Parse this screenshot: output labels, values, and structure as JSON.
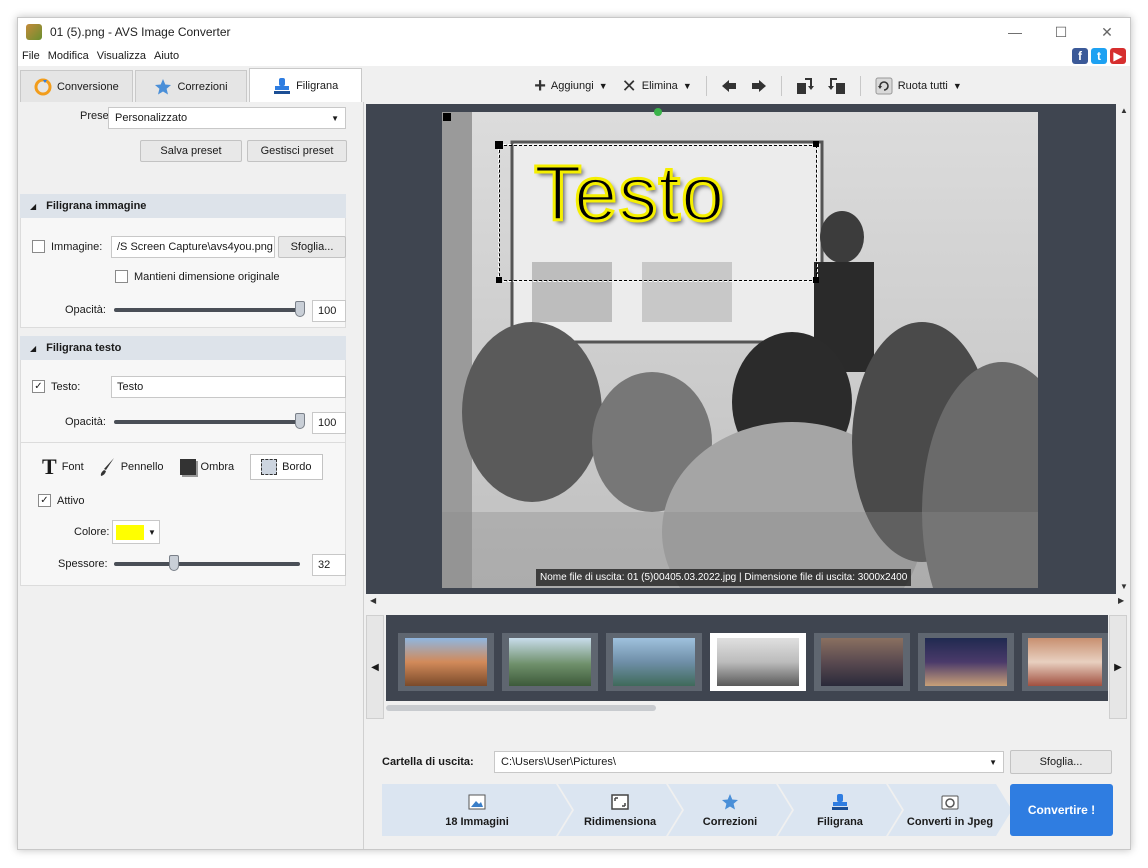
{
  "window": {
    "title": "01 (5).png - AVS Image Converter",
    "controls": {
      "minimize": "—",
      "maximize": "☐",
      "close": "✕"
    }
  },
  "menu": [
    "File",
    "Modifica",
    "Visualizza",
    "Aiuto"
  ],
  "social": {
    "facebook": "f",
    "twitter": "t",
    "youtube": "▶"
  },
  "tabs": [
    {
      "label": "Conversione",
      "icon": "convert-icon",
      "active": false
    },
    {
      "label": "Correzioni",
      "icon": "star-icon",
      "active": false
    },
    {
      "label": "Filigrana",
      "icon": "stamp-icon",
      "active": true
    }
  ],
  "toolbar": {
    "add_label": "Aggiungi",
    "delete_label": "Elimina",
    "rotate_all_label": "Ruota tutti"
  },
  "left": {
    "preset_label": "Preset:",
    "preset_value": "Personalizzato",
    "save_preset": "Salva preset",
    "manage_preset": "Gestisci preset",
    "image_wm": {
      "title": "Filigrana immagine",
      "image_label": "Immagine:",
      "image_path": "/S Screen Capture\\avs4you.png",
      "browse": "Sfoglia...",
      "keep_size": "Mantieni dimensione originale",
      "opacity_label": "Opacità:",
      "opacity_value": "100",
      "opacity_fraction": 1.0
    },
    "text_wm": {
      "title": "Filigrana testo",
      "text_label": "Testo:",
      "text_value": "Testo",
      "opacity_label": "Opacità:",
      "opacity_value": "100",
      "opacity_fraction": 1.0,
      "tabs": {
        "font": "Font",
        "brush": "Pennello",
        "shadow": "Ombra",
        "border": "Bordo"
      },
      "active_label": "Attivo",
      "color_label": "Colore:",
      "color": "#ffff00",
      "thickness_label": "Spessore:",
      "thickness_value": "32",
      "thickness_fraction": 0.32
    }
  },
  "preview": {
    "watermark_text": "Testo",
    "output_info": "Nome file di uscita: 01 (5)00405.03.2022.jpg | Dimensione file di uscita: 3000x2400"
  },
  "output": {
    "label": "Cartella di uscita:",
    "path": "C:\\Users\\User\\Pictures\\",
    "browse": "Sfoglia..."
  },
  "steps": [
    {
      "label": "18 Immagini",
      "icon": "images-icon"
    },
    {
      "label": "Ridimensiona",
      "icon": "resize-icon"
    },
    {
      "label": "Correzioni",
      "icon": "star-icon"
    },
    {
      "label": "Filigrana",
      "icon": "stamp-icon"
    },
    {
      "label": "Converti in Jpeg",
      "icon": "camera-icon"
    }
  ],
  "convert_button": "Convertire !",
  "colors": {
    "accent": "#2f7de1",
    "dark_bg": "#3f4550",
    "step_bg": "#dbe5f1"
  }
}
